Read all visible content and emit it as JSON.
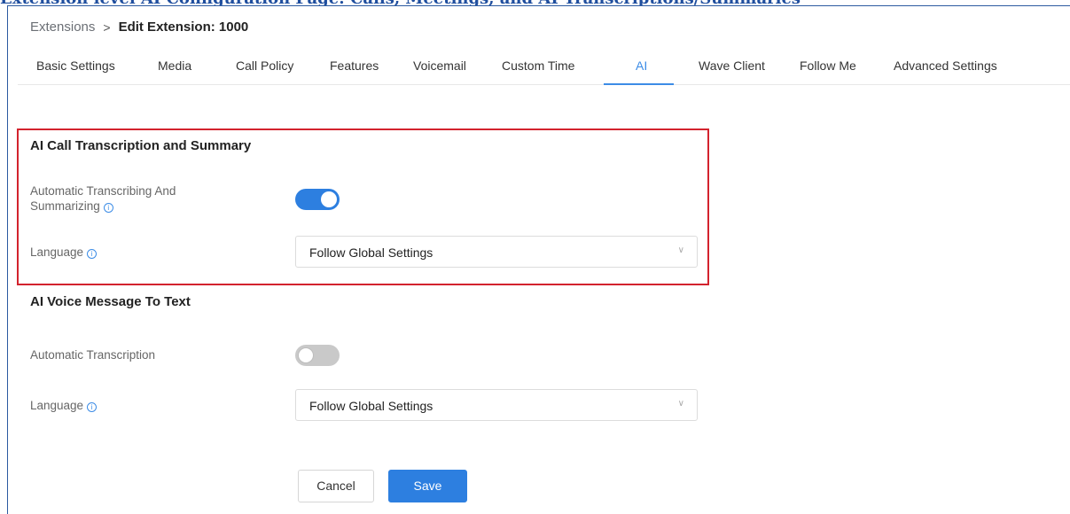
{
  "document_heading": "Extension level AI Configuration Page: Calls, Meetings, and AI Transcriptions/Summaries",
  "breadcrumb": {
    "parent": "Extensions",
    "separator": ">",
    "current": "Edit Extension: 1000"
  },
  "tabs": [
    {
      "label": "Basic Settings"
    },
    {
      "label": "Media"
    },
    {
      "label": "Call Policy"
    },
    {
      "label": "Features"
    },
    {
      "label": "Voicemail"
    },
    {
      "label": "Custom Time"
    },
    {
      "label": "AI",
      "active": true
    },
    {
      "label": "Wave Client"
    },
    {
      "label": "Follow Me"
    },
    {
      "label": "Advanced Settings"
    }
  ],
  "ai_call_section": {
    "title": "AI Call Transcription and Summary",
    "auto_label_line1": "Automatic Transcribing And",
    "auto_label_line2": "Summarizing",
    "auto_enabled": true,
    "language_label": "Language",
    "language_value": "Follow Global Settings"
  },
  "ai_voice_section": {
    "title": "AI Voice Message To Text",
    "auto_label": "Automatic Transcription",
    "auto_enabled": false,
    "language_label": "Language",
    "language_value": "Follow Global Settings"
  },
  "actions": {
    "cancel_label": "Cancel",
    "save_label": "Save"
  },
  "icons": {
    "info": "info-circle-icon",
    "dropdown": "chevron-down-icon"
  },
  "colors": {
    "accent": "#2d7fe0",
    "highlight_border": "#d3232e",
    "heading": "#1f4e9e"
  }
}
